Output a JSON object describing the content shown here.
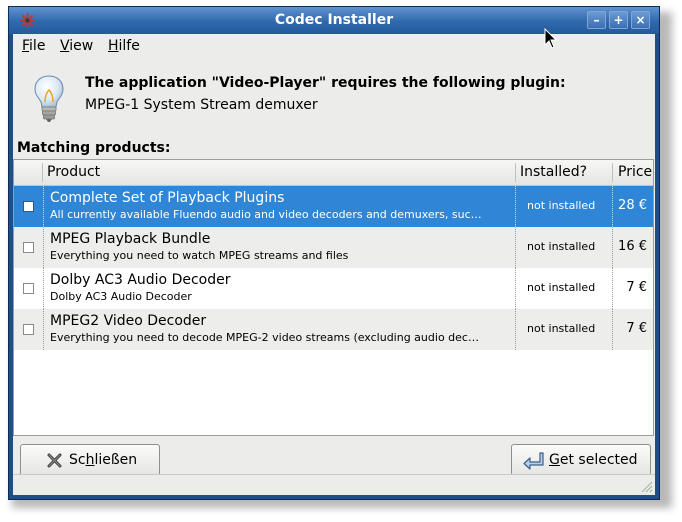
{
  "window": {
    "title": "Codec Installer",
    "controls": {
      "minimize": "–",
      "maximize": "+",
      "close": "×"
    }
  },
  "menu": [
    {
      "label": "File",
      "mnemonic": "F",
      "rest": "ile"
    },
    {
      "label": "View",
      "mnemonic": "V",
      "rest": "iew"
    },
    {
      "label": "Hilfe",
      "mnemonic": "H",
      "rest": "ilfe"
    }
  ],
  "message": {
    "headline": "The application \"Video-Player\" requires the following plugin:",
    "plugin": "MPEG-1 System Stream demuxer",
    "icon": "lightbulb-info-icon"
  },
  "products_label": "Matching products:",
  "table": {
    "columns": [
      "Product",
      "Installed?",
      "Price"
    ],
    "rows": [
      {
        "name": "Complete Set of Playback Plugins",
        "description": "All currently available Fluendo audio and video decoders and demuxers, suc…",
        "status": "not installed",
        "price": "28 €",
        "checked": false,
        "selected": true
      },
      {
        "name": "MPEG Playback Bundle",
        "description": "Everything you need to watch MPEG streams and files",
        "status": "not installed",
        "price": "16 €",
        "checked": false,
        "selected": false
      },
      {
        "name": "Dolby AC3 Audio Decoder",
        "description": "Dolby AC3 Audio Decoder",
        "status": "not installed",
        "price": "7 €",
        "checked": false,
        "selected": false
      },
      {
        "name": "MPEG2 Video Decoder",
        "description": "Everything you need to decode MPEG-2 video streams (excluding audio dec…",
        "status": "not installed",
        "price": "7 €",
        "checked": false,
        "selected": false
      }
    ]
  },
  "buttons": {
    "close": {
      "label": "Schließen",
      "mnemonic": "h",
      "pre": "Sc",
      "post": "ließen",
      "icon": "close-x-icon"
    },
    "get": {
      "label": "Get selected",
      "mnemonic": "G",
      "pre": "",
      "post": "et selected",
      "icon": "return-arrow-icon"
    }
  },
  "colors": {
    "titlebar": "#2f68ad",
    "selection": "#2f86d6",
    "background": "#ececea"
  }
}
